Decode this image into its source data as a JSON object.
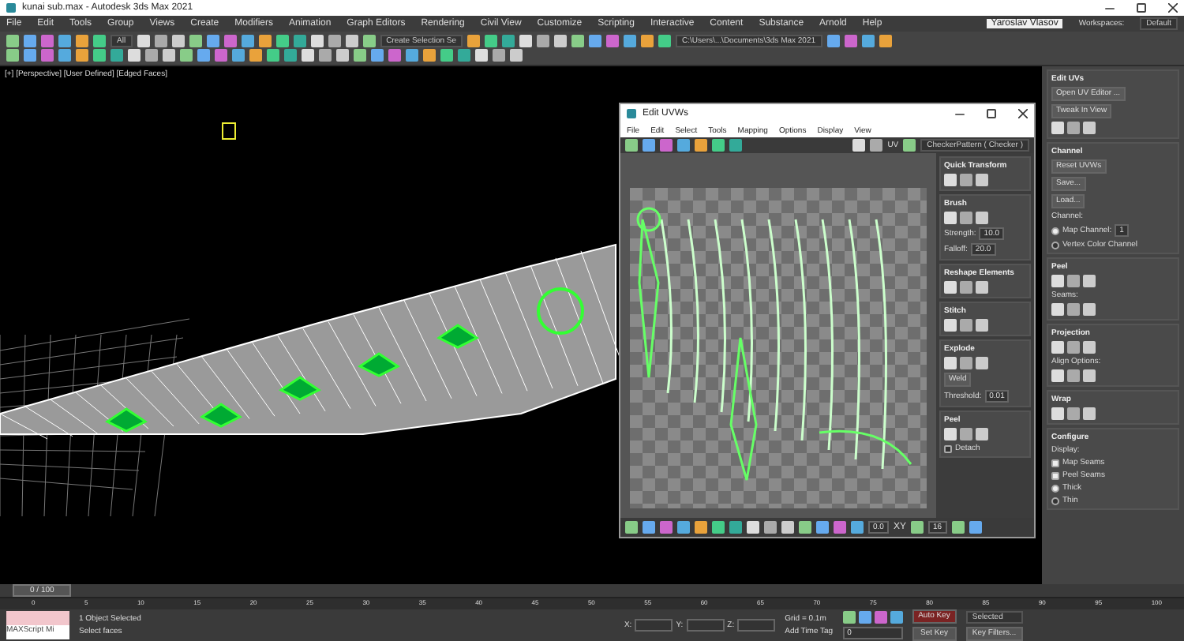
{
  "window": {
    "title": "kunai sub.max - Autodesk 3ds Max 2021"
  },
  "menu": [
    "File",
    "Edit",
    "Tools",
    "Group",
    "Views",
    "Create",
    "Modifiers",
    "Animation",
    "Graph Editors",
    "Rendering",
    "Civil View",
    "Customize",
    "Scripting",
    "Interactive",
    "Content",
    "Substance",
    "Arnold",
    "Help"
  ],
  "user": "Yaroslav Vlasov",
  "workspaces": {
    "label": "Workspaces:",
    "value": "Default"
  },
  "toolbar": {
    "filter": "All",
    "selection_set": "Create Selection Se",
    "project_path": "C:\\Users\\...\\Documents\\3ds Max 2021"
  },
  "viewport": {
    "label": "[+] [Perspective] [User Defined] [Edged Faces]"
  },
  "uv_editor": {
    "title": "Edit UVWs",
    "menu": [
      "File",
      "Edit",
      "Select",
      "Tools",
      "Mapping",
      "Options",
      "Display",
      "View"
    ],
    "mode": "UV",
    "texture": "CheckerPattern ( Checker )",
    "rollouts": [
      {
        "title": "Quick Transform",
        "items": [
          {
            "kind": "icons"
          }
        ]
      },
      {
        "title": "Brush",
        "items": [
          {
            "kind": "icons"
          },
          {
            "kind": "field",
            "label": "Strength:",
            "value": "10.0"
          },
          {
            "kind": "field",
            "label": "Falloff:",
            "value": "20.0"
          }
        ]
      },
      {
        "title": "Reshape Elements",
        "items": [
          {
            "kind": "icons"
          }
        ]
      },
      {
        "title": "Stitch",
        "items": [
          {
            "kind": "icons"
          }
        ]
      },
      {
        "title": "Explode",
        "items": [
          {
            "kind": "icons"
          },
          {
            "kind": "button",
            "label": "Weld"
          },
          {
            "kind": "field",
            "label": "Threshold:",
            "value": "0.01"
          }
        ]
      },
      {
        "title": "Peel",
        "items": [
          {
            "kind": "icons"
          },
          {
            "kind": "check",
            "label": "Detach",
            "checked": false
          }
        ]
      }
    ],
    "status": {
      "value": "0.0",
      "axis": "XY",
      "grid": "16"
    }
  },
  "command_panel": [
    {
      "title": "Edit UVs",
      "items": [
        {
          "kind": "button",
          "label": "Open UV Editor ..."
        },
        {
          "kind": "button",
          "label": "Tweak In View"
        },
        {
          "kind": "icons"
        }
      ]
    },
    {
      "title": "Channel",
      "items": [
        {
          "kind": "button",
          "label": "Reset UVWs"
        },
        {
          "kind": "button",
          "label": "Save..."
        },
        {
          "kind": "button",
          "label": "Load..."
        },
        {
          "kind": "label",
          "text": "Channel:"
        },
        {
          "kind": "radio",
          "label": "Map Channel:",
          "value": "1",
          "selected": true
        },
        {
          "kind": "radio",
          "label": "Vertex Color Channel",
          "selected": false
        }
      ]
    },
    {
      "title": "Peel",
      "items": [
        {
          "kind": "icons"
        },
        {
          "kind": "label",
          "text": "Seams:"
        },
        {
          "kind": "icons"
        }
      ]
    },
    {
      "title": "Projection",
      "items": [
        {
          "kind": "icons"
        },
        {
          "kind": "label",
          "text": "Align Options:"
        },
        {
          "kind": "icons"
        }
      ]
    },
    {
      "title": "Wrap",
      "items": [
        {
          "kind": "icons"
        }
      ]
    },
    {
      "title": "Configure",
      "items": [
        {
          "kind": "label",
          "text": "Display:"
        },
        {
          "kind": "check",
          "label": "Map Seams",
          "checked": true
        },
        {
          "kind": "check",
          "label": "Peel Seams",
          "checked": true
        },
        {
          "kind": "radio",
          "label": "Thick",
          "selected": true
        },
        {
          "kind": "radio",
          "label": "Thin",
          "selected": false
        }
      ]
    }
  ],
  "timeline": {
    "position": "0 / 100",
    "ticks": [
      "0",
      "5",
      "10",
      "15",
      "20",
      "25",
      "30",
      "35",
      "40",
      "45",
      "50",
      "55",
      "60",
      "65",
      "70",
      "75",
      "80",
      "85",
      "90",
      "95",
      "100"
    ]
  },
  "status_bar": {
    "script": "MAXScript Mi",
    "selection": "1 Object Selected",
    "prompt": "Select faces",
    "coords": [
      "X:",
      "Y:",
      "Z:"
    ],
    "grid": "Grid = 0.1m",
    "time_tag": "Add Time Tag",
    "auto_key": "Auto Key",
    "key_mode": "Selected",
    "set_key": "Set Key",
    "key_filters": "Key Filters...",
    "frame": "0"
  }
}
